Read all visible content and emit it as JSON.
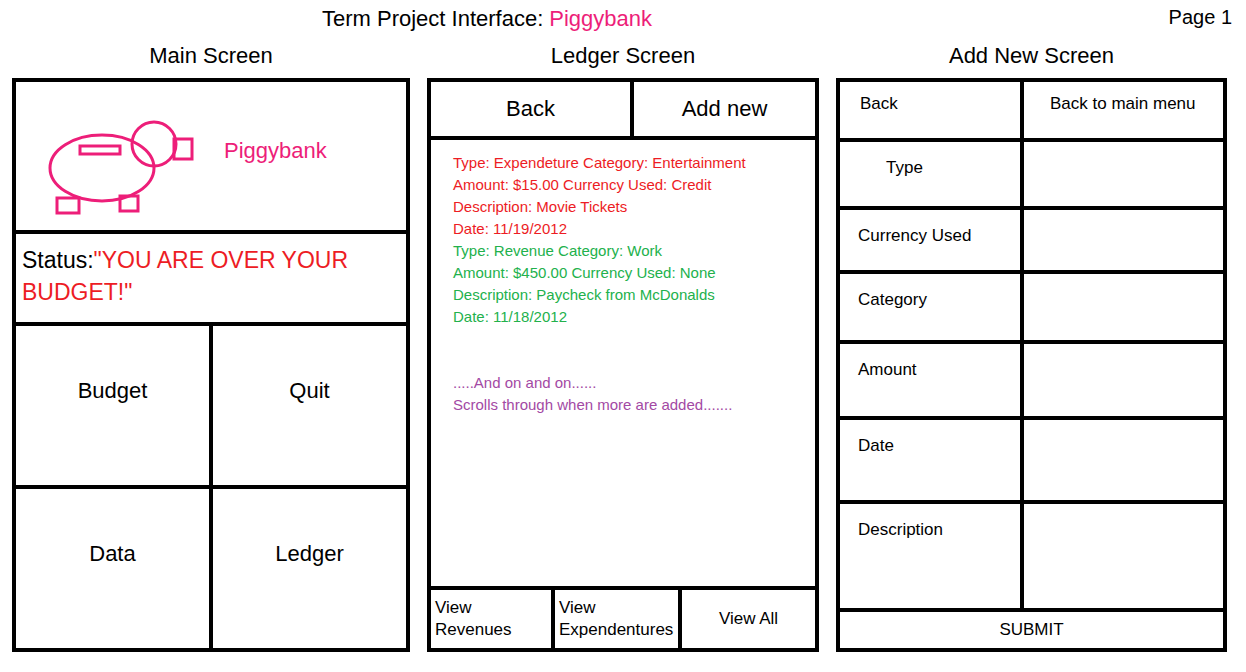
{
  "header": {
    "label": "Term Project Interface:",
    "app_name": "Piggybank",
    "page": "Page 1"
  },
  "main_screen": {
    "heading": "Main Screen",
    "logo_text": "Piggybank",
    "status_label": "Status:",
    "status_value": "\"YOU ARE OVER YOUR BUDGET!\"",
    "buttons": [
      "Budget",
      "Quit",
      "Data",
      "Ledger"
    ]
  },
  "ledger_screen": {
    "heading": "Ledger Screen",
    "back": "Back",
    "add_new": "Add new",
    "entries": [
      {
        "lines": [
          "Type: Expendeture  Category: Entertainment",
          "Amount: $15.00 Currency Used: Credit",
          "Description: Movie Tickets",
          "Date: 11/19/2012"
        ],
        "color": "#ed1c24"
      },
      {
        "lines": [
          "Type: Revenue Category: Work",
          "Amount: $450.00 Currency Used: None",
          "Description: Paycheck from McDonalds",
          "Date: 11/18/2012"
        ],
        "color": "#22b14c"
      }
    ],
    "notes": [
      ".....And on and on......",
      "Scrolls through when more are added......."
    ],
    "filters": [
      "View Revenues",
      "View Expendentures",
      "View All"
    ]
  },
  "add_new_screen": {
    "heading": "Add New Screen",
    "back": "Back",
    "main_menu": "Back to main menu",
    "fields": [
      "Type",
      "Currency Used",
      "Category",
      "Amount",
      "Date",
      "Description"
    ],
    "submit": "SUBMIT"
  }
}
